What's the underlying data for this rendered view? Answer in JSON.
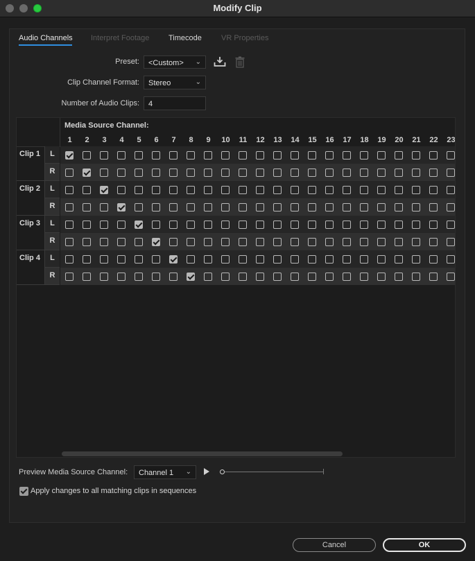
{
  "window": {
    "title": "Modify Clip"
  },
  "tabs": [
    {
      "label": "Audio Channels",
      "active": true
    },
    {
      "label": "Interpret Footage",
      "active": false
    },
    {
      "label": "Timecode",
      "active": false
    },
    {
      "label": "VR Properties",
      "active": false
    }
  ],
  "preset": {
    "label": "Preset:",
    "value": "<Custom>"
  },
  "clip_channel_format": {
    "label": "Clip Channel Format:",
    "value": "Stereo"
  },
  "num_audio_clips": {
    "label": "Number of Audio Clips:",
    "value": "4"
  },
  "grid": {
    "header": "Media Source Channel:",
    "columns": [
      "1",
      "2",
      "3",
      "4",
      "5",
      "6",
      "7",
      "8",
      "9",
      "10",
      "11",
      "12",
      "13",
      "14",
      "15",
      "16",
      "17",
      "18",
      "19",
      "20",
      "21",
      "22",
      "23"
    ],
    "clips": [
      {
        "label": "Clip 1",
        "rows": [
          {
            "channel": "L",
            "checked_col": 1
          },
          {
            "channel": "R",
            "checked_col": 2
          }
        ]
      },
      {
        "label": "Clip 2",
        "rows": [
          {
            "channel": "L",
            "checked_col": 3
          },
          {
            "channel": "R",
            "checked_col": 4
          }
        ]
      },
      {
        "label": "Clip 3",
        "rows": [
          {
            "channel": "L",
            "checked_col": 5
          },
          {
            "channel": "R",
            "checked_col": 6
          }
        ]
      },
      {
        "label": "Clip 4",
        "rows": [
          {
            "channel": "L",
            "checked_col": 7
          },
          {
            "channel": "R",
            "checked_col": 8
          }
        ]
      }
    ]
  },
  "preview": {
    "label": "Preview Media Source Channel:",
    "value": "Channel 1"
  },
  "apply_changes": {
    "label": "Apply changes to all matching clips in sequences",
    "checked": true
  },
  "buttons": {
    "cancel": "Cancel",
    "ok": "OK"
  }
}
